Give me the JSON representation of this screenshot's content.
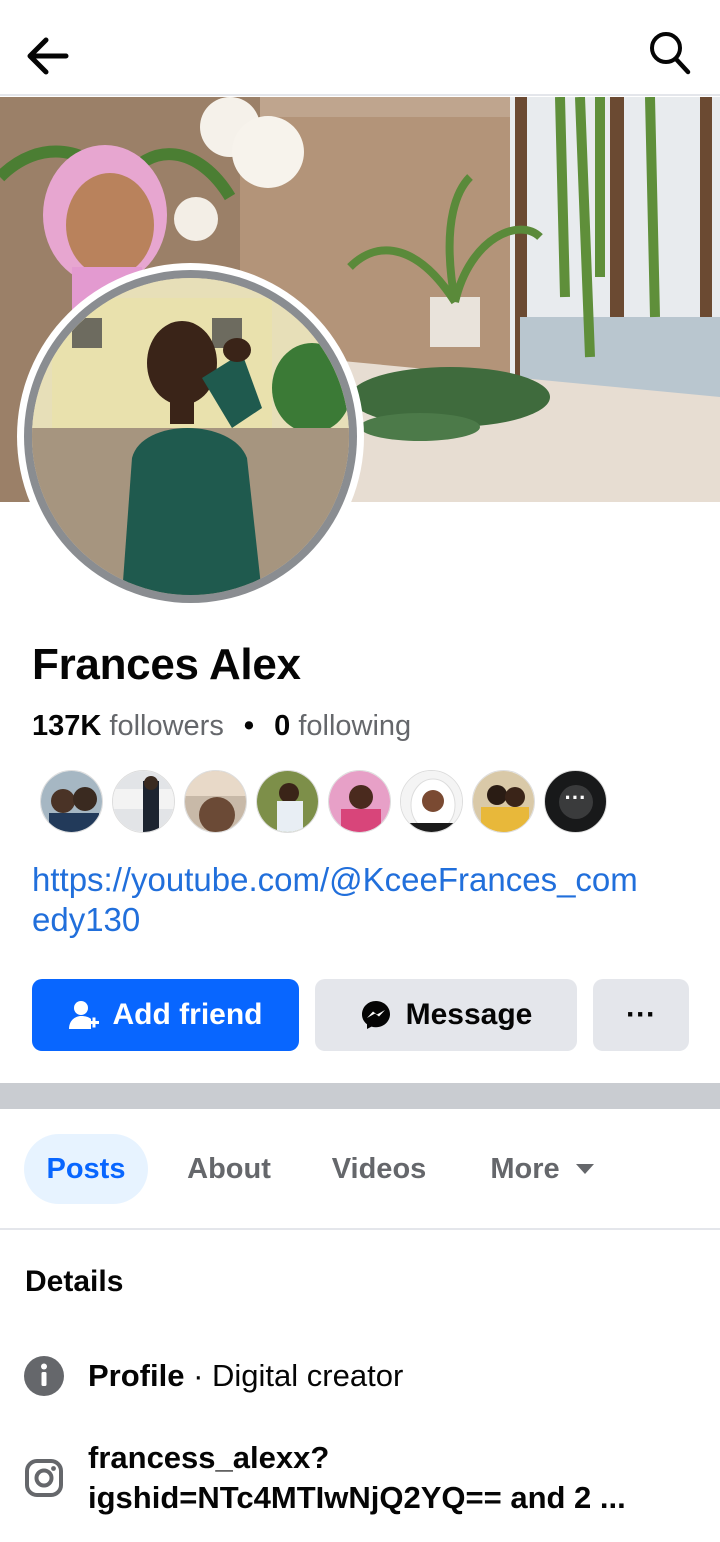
{
  "profile": {
    "name": "Frances Alex",
    "followers_count": "137K",
    "followers_label": "followers",
    "following_count": "0",
    "following_label": "following",
    "link": "https://youtube.com/@KceeFrances_comedy130"
  },
  "actions": {
    "add_friend": "Add friend",
    "message": "Message",
    "more": "···"
  },
  "tabs": [
    {
      "label": "Posts",
      "active": true
    },
    {
      "label": "About",
      "active": false
    },
    {
      "label": "Videos",
      "active": false
    },
    {
      "label": "More",
      "active": false
    }
  ],
  "details": {
    "title": "Details",
    "profile_label": "Profile",
    "profile_value": "· Digital creator",
    "instagram": "francess_alexx?igshid=NTc4MTIwNjQ2YQ== and 2 ..."
  },
  "icons": {
    "back": "arrow-left-icon",
    "search": "search-icon",
    "add_friend": "add-person-icon",
    "message": "messenger-icon",
    "info": "info-icon",
    "instagram": "instagram-icon"
  },
  "colors": {
    "primary": "#0866ff",
    "link": "#216fdb",
    "secondary_button": "#e4e6eb",
    "active_tab_bg": "#e7f3ff",
    "muted_text": "#65676b"
  }
}
